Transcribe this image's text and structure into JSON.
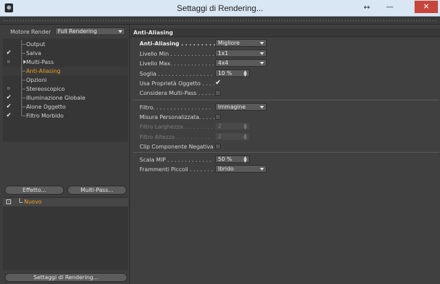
{
  "window": {
    "title": "Settaggi di Rendering...",
    "close_glyph": "✕",
    "minimize_glyph": "—",
    "resize_glyph": "↔"
  },
  "left": {
    "renderer_label": "Motore Render",
    "renderer_value": "Full Rendering",
    "tree": [
      {
        "label": "Output",
        "state": "none"
      },
      {
        "label": "Salva",
        "state": "checked"
      },
      {
        "label": "Multi-Pass",
        "state": "box",
        "expander": true
      },
      {
        "label": "Anti-Aliasing",
        "state": "none",
        "active": true
      },
      {
        "label": "Opzioni",
        "state": "none"
      },
      {
        "label": "Stereoscopico",
        "state": "box"
      },
      {
        "label": "Illuminazione Globale",
        "state": "checked"
      },
      {
        "label": "Alone Oggetto",
        "state": "checked"
      },
      {
        "label": "Filtro Morbido",
        "state": "checked"
      }
    ],
    "effect_button": "Effetto...",
    "multipass_button": "Multi-Pass...",
    "preset_label": "Nuovo",
    "settings_button": "Settaggi di Rendering..."
  },
  "right": {
    "section_title": "Anti-Aliasing",
    "anti_aliasing": {
      "label": "Anti-Aliasing . . . . . . . . . . . .",
      "value": "Migliore"
    },
    "min_level": {
      "label": "Livello Min . . . . . . . . . . . . .",
      "value": "1x1"
    },
    "max_level": {
      "label": "Livello Max. . . . . . . . . . . . .",
      "value": "4x4"
    },
    "threshold": {
      "label": "Soglia . . . . . . . . . . . . . . . .",
      "value": "10 %"
    },
    "use_object_props": {
      "label": "Usa Proprietà Oggetto . . . .",
      "checked": true
    },
    "consider_multipass": {
      "label": "Considera Multi-Pass . . . . .",
      "checked": false
    },
    "filter": {
      "label": "Filtro. . . . . . . . . . . . . . . . .",
      "value": "Immagine"
    },
    "custom_size": {
      "label": "Misura Personalizzata. . . . .",
      "checked": false
    },
    "filter_width": {
      "label": "Filtro Larghezza. . . . . . . . .",
      "value": "2"
    },
    "filter_height": {
      "label": "Filtro Altezza . . . . . . . . . .",
      "value": "2"
    },
    "clip_negative": {
      "label": "Clip Componente Negativa",
      "checked": false
    },
    "mip_scale": {
      "label": "Scala MIP . . . . . . . . . . . . .",
      "value": "50 %"
    },
    "small_fragments": {
      "label": "Frammenti Piccoli . . . . . . .",
      "value": "Ibrido"
    }
  },
  "icons": {
    "check": "✔",
    "app": "cinema4d-icon"
  }
}
